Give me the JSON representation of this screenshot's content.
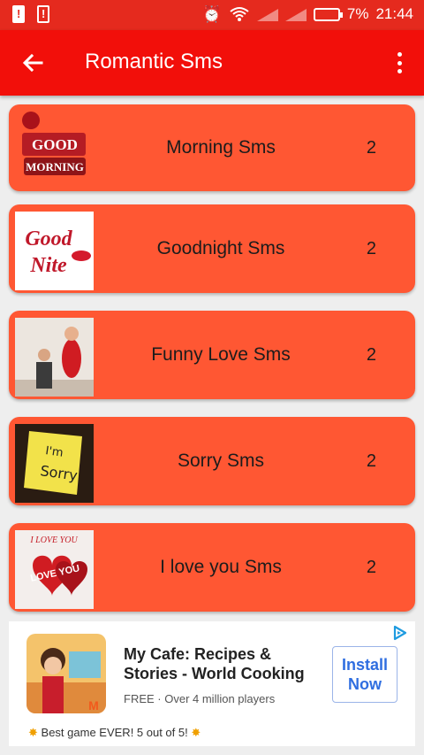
{
  "status_bar": {
    "battery": "7%",
    "time": "21:44",
    "icons": [
      "alert-icon",
      "alert-outline-icon",
      "alarm-icon",
      "wifi-icon",
      "signal-icon",
      "signal-icon",
      "battery-icon"
    ]
  },
  "appbar": {
    "title": "Romantic Sms",
    "back_icon": "arrow-left-icon",
    "menu_icon": "more-vert-icon"
  },
  "categories": [
    {
      "label": "Morning Sms",
      "count": "2",
      "thumb_text": "GOOD MORNING"
    },
    {
      "label": "Goodnight Sms",
      "count": "2",
      "thumb_text": "Good Nite"
    },
    {
      "label": "Funny Love Sms",
      "count": "2",
      "thumb_text": ""
    },
    {
      "label": "Sorry Sms",
      "count": "2",
      "thumb_text": "I'm Sorry"
    },
    {
      "label": "I love you Sms",
      "count": "2",
      "thumb_text": "I LOVE YOU"
    }
  ],
  "ad": {
    "title": "My Cafe: Recipes & Stories - World Cooking",
    "subtitle": "FREE · Over 4 million players",
    "install": "Install Now",
    "footer": "Best game EVER! 5 out of 5!"
  },
  "colors": {
    "status_bar": "#e52a1e",
    "app_bar": "#f20f0a",
    "card": "#ff5733",
    "background": "#eeeeee"
  }
}
